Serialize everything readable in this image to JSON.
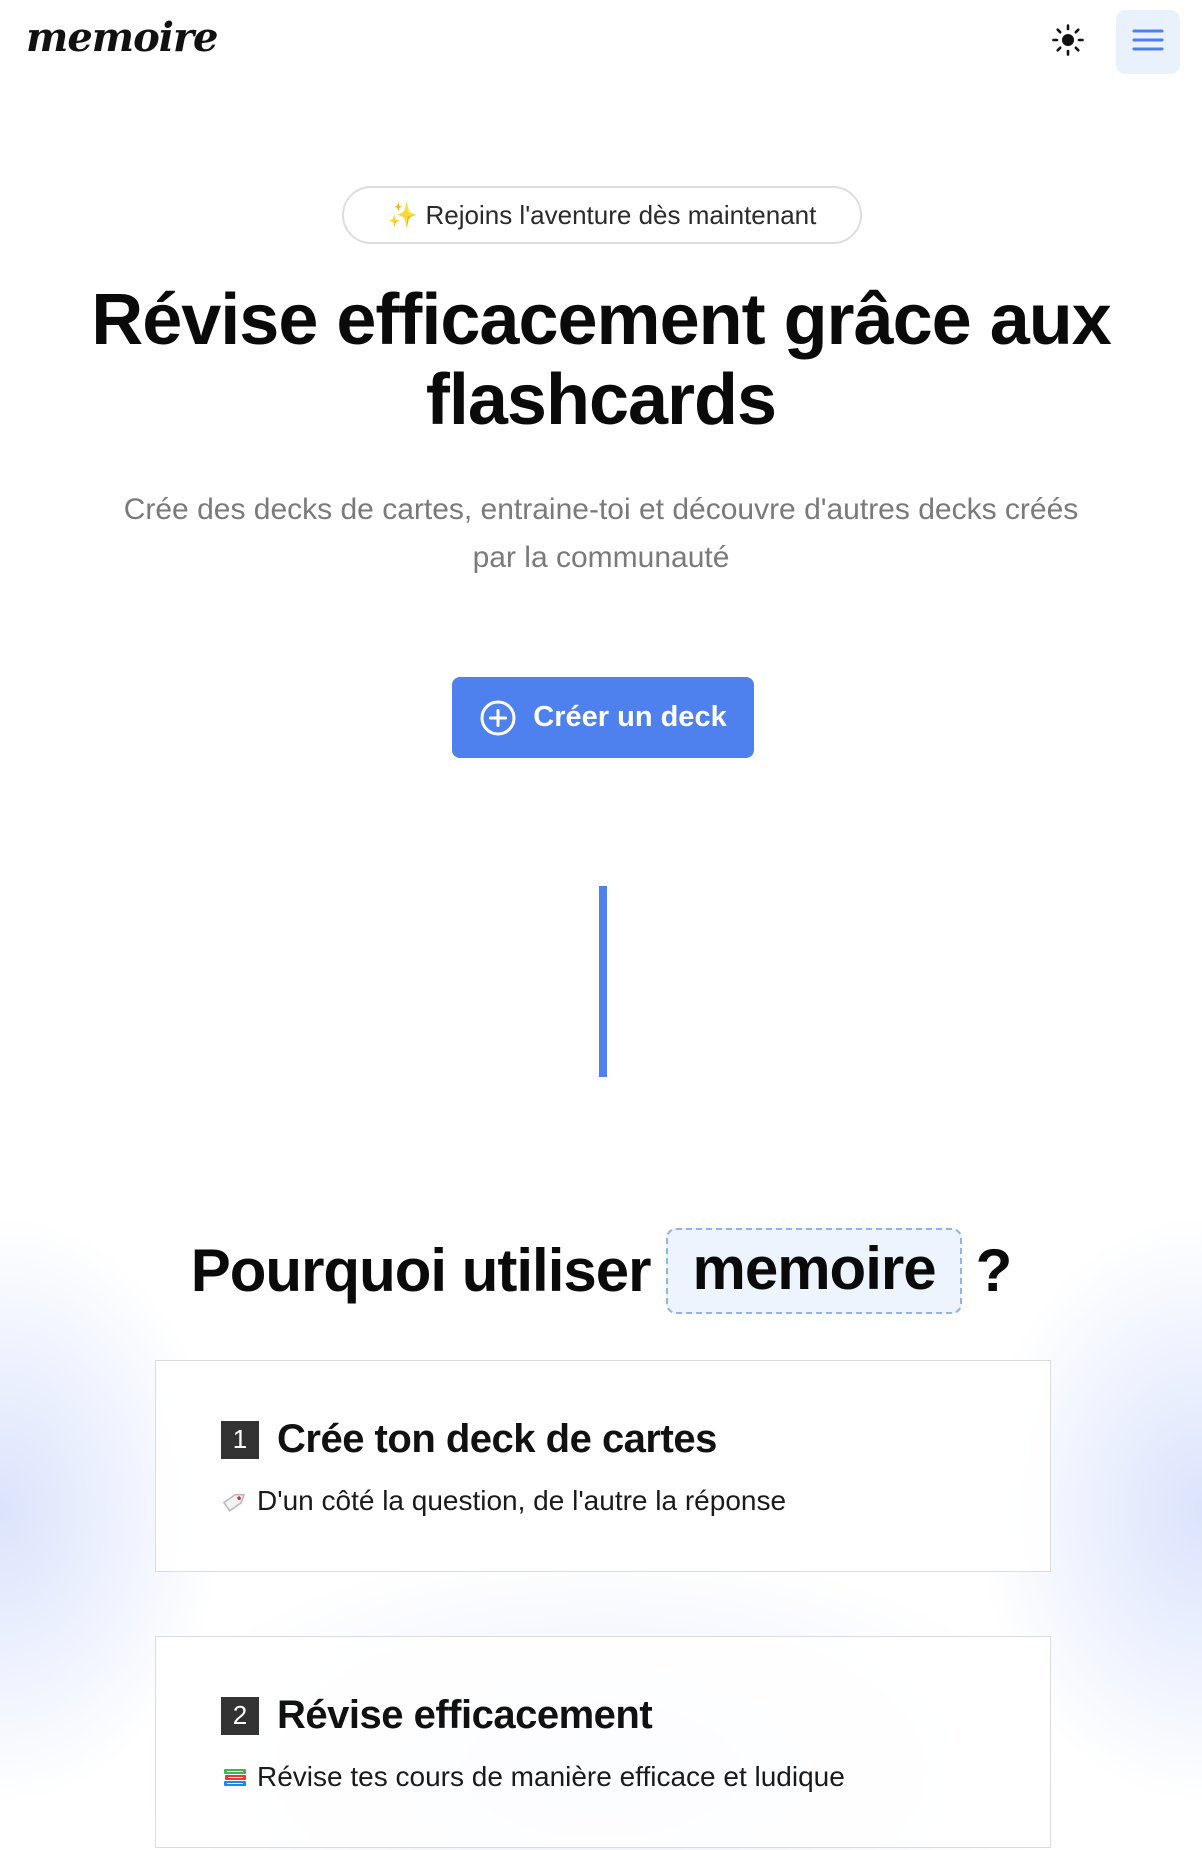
{
  "header": {
    "logo": "memoire",
    "theme_icon": "sun-icon",
    "menu_icon": "hamburger-menu-icon"
  },
  "hero": {
    "pill_emoji": "✨",
    "pill_text": "Rejoins l'aventure dès maintenant",
    "title": "Révise efficacement grâce aux flashcards",
    "subtitle": "Crée des decks de cartes, entraine-toi et découvre d'autres decks créés par la communauté",
    "cta_label": "Créer un deck",
    "cta_icon": "plus-circle-icon"
  },
  "why": {
    "title_prefix": "Pourquoi utiliser",
    "brand": "memoire",
    "title_suffix": "?",
    "features": [
      {
        "number": "1",
        "title": "Crée ton deck de cartes",
        "emoji": "label-tag-icon",
        "description": "D'un côté la question, de l'autre la réponse"
      },
      {
        "number": "2",
        "title": "Révise efficacement",
        "emoji": "books-icon",
        "description": "Révise tes cours de manière efficace et ludique"
      }
    ]
  },
  "colors": {
    "primary": "#4e81ee",
    "menu_bg": "#e9f1fd",
    "chip_border": "#8eb4ea",
    "chip_bg": "#eef4fd",
    "badge": "#333333"
  }
}
